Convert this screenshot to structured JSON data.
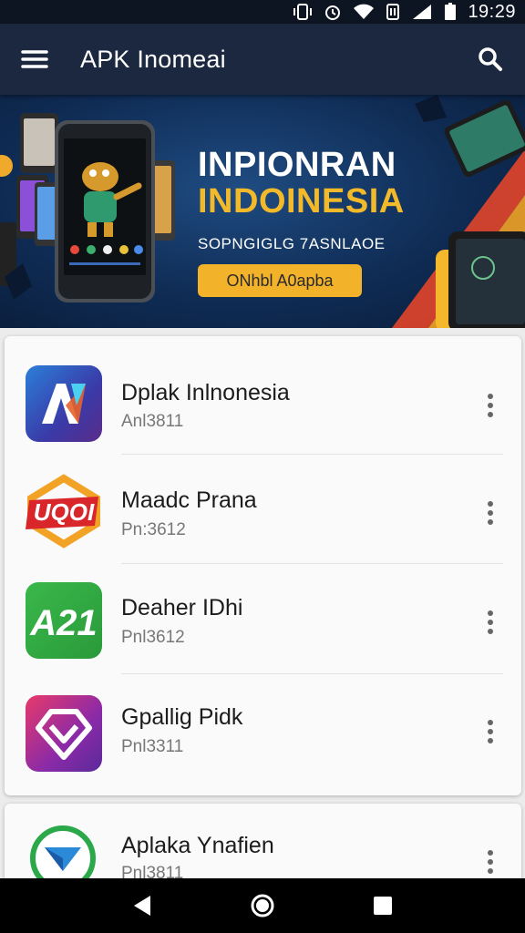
{
  "status_bar": {
    "time": "19:29",
    "icons": [
      "vibrate-icon",
      "alarm-icon",
      "wifi-icon",
      "nfc-icon",
      "signal-icon",
      "battery-icon"
    ]
  },
  "app_bar": {
    "title": "APK Inomeai",
    "menu_icon": "hamburger-menu-icon",
    "search_icon": "search-icon"
  },
  "banner": {
    "title_line1": "INPIONRAN",
    "title_line2": "INDOINESIA",
    "subtitle": "SOPNGIGLG 7ASNLAOE",
    "button_label": "ONhbl A0apba",
    "colors": {
      "accent": "#f2b22a",
      "background": "#0f2c55"
    }
  },
  "apps": [
    {
      "name": "Dplak Inlnonesia",
      "sub": "Anl3811",
      "icon": "av-logo-icon"
    },
    {
      "name": "Maadc Prana",
      "sub": "Pn:3612",
      "icon": "uqoi-logo-icon"
    },
    {
      "name": "Deaher IDhi",
      "sub": "Pnl3612",
      "icon": "a21-logo-icon"
    },
    {
      "name": "Gpallig Pidk",
      "sub": "Pnl3311",
      "icon": "gem-logo-icon"
    },
    {
      "name": "Aplaka Ynafien",
      "sub": "Pnl3811",
      "icon": "arrow-logo-icon"
    }
  ],
  "nav": {
    "back_icon": "back-triangle-icon",
    "home_icon": "home-circle-icon",
    "recents_icon": "recents-square-icon"
  }
}
